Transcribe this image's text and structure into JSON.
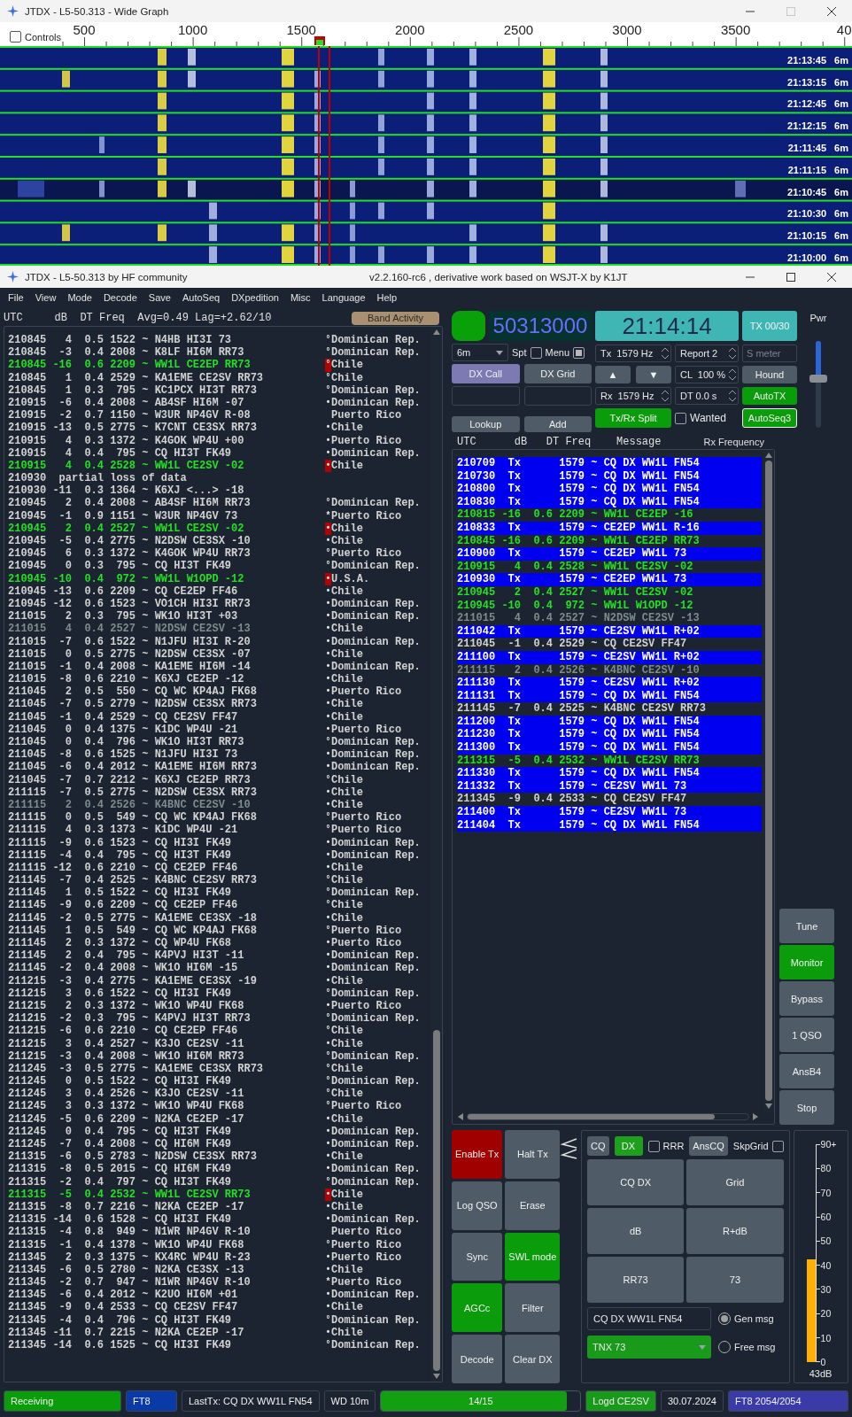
{
  "wide_graph": {
    "title": "JTDX - L5-50.313 - Wide Graph",
    "controls": {
      "label": "Controls",
      "checked": false
    },
    "ticks": [
      "500",
      "1000",
      "1500",
      "2000",
      "2500",
      "3000",
      "3500",
      "40"
    ],
    "rows": [
      {
        "time": "21:13:45",
        "band": "6m"
      },
      {
        "time": "21:13:15",
        "band": "6m"
      },
      {
        "time": "21:12:45",
        "band": "6m"
      },
      {
        "time": "21:12:15",
        "band": "6m"
      },
      {
        "time": "21:11:45",
        "band": "6m"
      },
      {
        "time": "21:11:15",
        "band": "6m"
      },
      {
        "time": "21:10:45",
        "band": "6m"
      },
      {
        "time": "21:10:30",
        "band": "6m"
      },
      {
        "time": "21:10:15",
        "band": "6m"
      },
      {
        "time": "21:10:00",
        "band": "6m"
      }
    ]
  },
  "main_window": {
    "title": "JTDX - L5-50.313  by HF community",
    "version": "v2.2.160-rc6 , derivative work based on WSJT-X by K1JT"
  },
  "menu": [
    "File",
    "View",
    "Mode",
    "Decode",
    "Save",
    "AutoSeq",
    "DXpedition",
    "Misc",
    "Language",
    "Help"
  ],
  "band_activity": {
    "header": "UTC     dB  DT Freq  Avg=0.49 Lag=+2.62/10",
    "button": "Band Activity",
    "rows": [
      {
        "kind": "decode",
        "text": "210845   4  0.5 1522 ~ N4HB HI3I 73",
        "mark": "°",
        "country": "Dominican Rep."
      },
      {
        "kind": "decode",
        "text": "210845  -3  0.4 2008 ~ K8LF HI6M RR73",
        "mark": "°",
        "country": "Dominican Rep."
      },
      {
        "kind": "mine",
        "text": "210845 -16  0.6 2209 ~ WW1L CE2EP RR73",
        "mark": "°",
        "country": "Chile"
      },
      {
        "kind": "decode",
        "text": "210845   1  0.4 2529 ~ KA1EME CE2SV RR73",
        "mark": "°",
        "country": "Chile"
      },
      {
        "kind": "decode",
        "text": "210845   1  0.3  795 ~ KC1PCX HI3T RR73",
        "mark": "°",
        "country": "Dominican Rep."
      },
      {
        "kind": "decode",
        "text": "210915  -6  0.4 2008 ~ AB4SF HI6M -07",
        "mark": "•",
        "country": "Dominican Rep."
      },
      {
        "kind": "decode",
        "text": "210915  -2  0.7 1150 ~ W3UR NP4GV R-08",
        "country": "Puerto Rico"
      },
      {
        "kind": "decode",
        "text": "210915 -13  0.5 2775 ~ K7CNT CE3SX RR73",
        "mark": "•",
        "country": "Chile"
      },
      {
        "kind": "decode",
        "text": "210915   4  0.3 1372 ~ K4GOK WP4U +00",
        "mark": "•",
        "country": "Puerto Rico"
      },
      {
        "kind": "decode",
        "text": "210915   4  0.4  795 ~ CQ HI3T FK49",
        "mark": "•",
        "country": "Dominican Rep."
      },
      {
        "kind": "mine",
        "text": "210915   4  0.4 2528 ~ WW1L CE2SV -02",
        "mark": "•",
        "country": "Chile"
      },
      {
        "kind": "note",
        "text": "210930  partial loss of data"
      },
      {
        "kind": "decode",
        "text": "210930 -11  0.3 1364 ~ K6XJ <...> -18"
      },
      {
        "kind": "decode",
        "text": "210945   2  0.4 2008 ~ AB4SF HI6M RR73",
        "mark": "°",
        "country": "Dominican Rep."
      },
      {
        "kind": "decode",
        "text": "210945  -1  0.9 1151 ~ W3UR NP4GV 73",
        "mark": "*",
        "country": "Puerto Rico"
      },
      {
        "kind": "mine",
        "text": "210945   2  0.4 2527 ~ WW1L CE2SV -02",
        "mark": "•",
        "country": "Chile"
      },
      {
        "kind": "decode",
        "text": "210945  -5  0.4 2775 ~ N2DSW CE3SX -10",
        "mark": "•",
        "country": "Chile"
      },
      {
        "kind": "decode",
        "text": "210945   6  0.3 1372 ~ K4GOK WP4U RR73",
        "mark": "°",
        "country": "Puerto Rico"
      },
      {
        "kind": "decode",
        "text": "210945   0  0.3  795 ~ CQ HI3T FK49",
        "mark": "°",
        "country": "Dominican Rep."
      },
      {
        "kind": "mine",
        "text": "210945 -10  0.4  972 ~ WW1L W1OPD -12",
        "mark": "•",
        "country": "U.S.A."
      },
      {
        "kind": "decode",
        "text": "210945 -13  0.6 2209 ~ CQ CE2EP FF46",
        "mark": "•",
        "country": "Chile"
      },
      {
        "kind": "decode",
        "text": "210945 -12  0.6 1523 ~ VO1CH HI3I RR73",
        "mark": "•",
        "country": "Dominican Rep."
      },
      {
        "kind": "decode",
        "text": "211015   2  0.3  795 ~ WK1O HI3T +03",
        "mark": "•",
        "country": "Dominican Rep."
      },
      {
        "kind": "old",
        "text": "211015   4  0.4 2527 ~ N2DSW CE2SV -13",
        "mark": "•",
        "country": "Chile"
      },
      {
        "kind": "decode",
        "text": "211015  -7  0.6 1522 ~ N1JFU HI3I R-20",
        "mark": "•",
        "country": "Dominican Rep."
      },
      {
        "kind": "decode",
        "text": "211015   0  0.5 2775 ~ N2DSW CE3SX -07",
        "mark": "•",
        "country": "Chile"
      },
      {
        "kind": "decode",
        "text": "211015  -1  0.4 2008 ~ KA1EME HI6M -14",
        "mark": "•",
        "country": "Dominican Rep."
      },
      {
        "kind": "decode",
        "text": "211015  -8  0.6 2210 ~ K6XJ CE2EP -12",
        "mark": "•",
        "country": "Chile"
      },
      {
        "kind": "decode",
        "text": "211045   2  0.5  550 ~ CQ WC KP4AJ FK68",
        "mark": "•",
        "country": "Puerto Rico"
      },
      {
        "kind": "decode",
        "text": "211045  -7  0.5 2779 ~ N2DSW CE3SX RR73",
        "mark": "•",
        "country": "Chile"
      },
      {
        "kind": "decode",
        "text": "211045  -1  0.4 2529 ~ CQ CE2SV FF47",
        "mark": "•",
        "country": "Chile"
      },
      {
        "kind": "decode",
        "text": "211045   0  0.4 1375 ~ K1DC WP4U -21",
        "mark": "•",
        "country": "Puerto Rico"
      },
      {
        "kind": "decode",
        "text": "211045   0  0.4  796 ~ WK1O HI3T RR73",
        "mark": "°",
        "country": "Dominican Rep."
      },
      {
        "kind": "decode",
        "text": "211045  -8  0.6 1525 ~ N1JFU HI3I 73",
        "mark": "•",
        "country": "Dominican Rep."
      },
      {
        "kind": "decode",
        "text": "211045  -6  0.4 2012 ~ KA1EME HI6M RR73",
        "mark": "•",
        "country": "Dominican Rep."
      },
      {
        "kind": "decode",
        "text": "211045  -7  0.7 2212 ~ K6XJ CE2EP RR73",
        "mark": "°",
        "country": "Chile"
      },
      {
        "kind": "decode",
        "text": "211115  -7  0.5 2775 ~ N2DSW CE3SX RR73",
        "mark": "•",
        "country": "Chile"
      },
      {
        "kind": "old",
        "text": "211115   2  0.4 2526 ~ K4BNC CE2SV -10",
        "mark": "•",
        "country": "Chile"
      },
      {
        "kind": "decode",
        "text": "211115   0  0.5  549 ~ CQ WC KP4AJ FK68",
        "mark": "°",
        "country": "Puerto Rico"
      },
      {
        "kind": "decode",
        "text": "211115   4  0.3 1373 ~ K1DC WP4U -21",
        "mark": "°",
        "country": "Puerto Rico"
      },
      {
        "kind": "decode",
        "text": "211115  -9  0.6 1523 ~ CQ HI3I FK49",
        "mark": "•",
        "country": "Dominican Rep."
      },
      {
        "kind": "decode",
        "text": "211115  -4  0.4  795 ~ CQ HI3T FK49",
        "mark": "•",
        "country": "Dominican Rep."
      },
      {
        "kind": "decode",
        "text": "211115 -12  0.6 2210 ~ CQ CE2EP FF46",
        "mark": "•",
        "country": "Chile"
      },
      {
        "kind": "decode",
        "text": "211145  -7  0.4 2525 ~ K4BNC CE2SV RR73",
        "mark": "°",
        "country": "Chile"
      },
      {
        "kind": "decode",
        "text": "211145   1  0.5 1522 ~ CQ HI3I FK49",
        "mark": "°",
        "country": "Dominican Rep."
      },
      {
        "kind": "decode",
        "text": "211145  -9  0.6 2209 ~ CQ CE2EP FF46",
        "mark": "°",
        "country": "Chile"
      },
      {
        "kind": "decode",
        "text": "211145  -2  0.5 2775 ~ KA1EME CE3SX -18",
        "mark": "•",
        "country": "Chile"
      },
      {
        "kind": "decode",
        "text": "211145   1  0.5  549 ~ CQ WC KP4AJ FK68",
        "mark": "°",
        "country": "Puerto Rico"
      },
      {
        "kind": "decode",
        "text": "211145   2  0.3 1372 ~ CQ WP4U FK68",
        "mark": "•",
        "country": "Puerto Rico"
      },
      {
        "kind": "decode",
        "text": "211145   2  0.4  795 ~ K4PVJ HI3T -11",
        "mark": "•",
        "country": "Dominican Rep."
      },
      {
        "kind": "decode",
        "text": "211145  -2  0.4 2008 ~ WK1O HI6M -15",
        "mark": "•",
        "country": "Dominican Rep."
      },
      {
        "kind": "decode",
        "text": "211215  -3  0.4 2775 ~ KA1EME CE3SX -19",
        "mark": "•",
        "country": "Chile"
      },
      {
        "kind": "decode",
        "text": "211215   3  0.6 1522 ~ CQ HI3I FK49",
        "mark": "°",
        "country": "Dominican Rep."
      },
      {
        "kind": "decode",
        "text": "211215   2  0.3 1372 ~ WK1O WP4U FK68",
        "mark": "•",
        "country": "Puerto Rico"
      },
      {
        "kind": "decode",
        "text": "211215  -2  0.3  795 ~ K4PVJ HI3T RR73",
        "mark": "°",
        "country": "Dominican Rep."
      },
      {
        "kind": "decode",
        "text": "211215  -6  0.6 2210 ~ CQ CE2EP FF46",
        "mark": "°",
        "country": "Chile"
      },
      {
        "kind": "decode",
        "text": "211215   3  0.4 2527 ~ K3JO CE2SV -11",
        "mark": "•",
        "country": "Chile"
      },
      {
        "kind": "decode",
        "text": "211215  -3  0.4 2008 ~ WK1O HI6M RR73",
        "mark": "°",
        "country": "Dominican Rep."
      },
      {
        "kind": "decode",
        "text": "211245  -3  0.5 2775 ~ KA1EME CE3SX RR73",
        "mark": "°",
        "country": "Chile"
      },
      {
        "kind": "decode",
        "text": "211245   0  0.5 1522 ~ CQ HI3I FK49",
        "mark": "°",
        "country": "Dominican Rep."
      },
      {
        "kind": "decode",
        "text": "211245   3  0.4 2526 ~ K3JO CE2SV -11",
        "mark": "°",
        "country": "Chile"
      },
      {
        "kind": "decode",
        "text": "211245   3  0.3 1372 ~ WK1O WP4U FK68",
        "mark": "°",
        "country": "Puerto Rico"
      },
      {
        "kind": "decode",
        "text": "211245  -5  0.6 2209 ~ N2KA CE2EP -17",
        "mark": "•",
        "country": "Chile"
      },
      {
        "kind": "decode",
        "text": "211245   0  0.4  795 ~ CQ HI3T FK49",
        "mark": "•",
        "country": "Dominican Rep."
      },
      {
        "kind": "decode",
        "text": "211245  -7  0.4 2008 ~ CQ HI6M FK49",
        "mark": "•",
        "country": "Dominican Rep."
      },
      {
        "kind": "decode",
        "text": "211315  -6  0.5 2783 ~ N2DSW CE3SX RR73",
        "mark": "•",
        "country": "Chile"
      },
      {
        "kind": "decode",
        "text": "211315  -8  0.5 2015 ~ CQ HI6M FK49",
        "mark": "•",
        "country": "Dominican Rep."
      },
      {
        "kind": "decode",
        "text": "211315  -2  0.4  797 ~ CQ HI3T FK49",
        "mark": "°",
        "country": "Dominican Rep."
      },
      {
        "kind": "mine",
        "text": "211315  -5  0.4 2532 ~ WW1L CE2SV RR73",
        "mark": "•",
        "country": "Chile"
      },
      {
        "kind": "decode",
        "text": "211315  -8  0.7 2216 ~ N2KA CE2EP -17",
        "mark": "•",
        "country": "Chile"
      },
      {
        "kind": "decode",
        "text": "211315 -14  0.6 1528 ~ CQ HI3I FK49",
        "mark": "•",
        "country": "Dominican Rep."
      },
      {
        "kind": "decode",
        "text": "211315  -4  0.8  949 ~ N1WR NP4GV R-10",
        "country": "Puerto Rico"
      },
      {
        "kind": "decode",
        "text": "211315  -1  0.4 1378 ~ WK1O WP4U FK68",
        "mark": "°",
        "country": "Puerto Rico"
      },
      {
        "kind": "decode",
        "text": "211345   2  0.3 1375 ~ KX4RC WP4U R-23",
        "mark": "•",
        "country": "Puerto Rico"
      },
      {
        "kind": "decode",
        "text": "211345  -6  0.5 2780 ~ N2KA CE3SX -13",
        "mark": "•",
        "country": "Chile"
      },
      {
        "kind": "decode",
        "text": "211345  -2  0.7  947 ~ N1WR NP4GV R-10",
        "mark": "*",
        "country": "Puerto Rico"
      },
      {
        "kind": "decode",
        "text": "211345  -6  0.4 2012 ~ K2UO HI6M +01",
        "mark": "•",
        "country": "Dominican Rep."
      },
      {
        "kind": "decode",
        "text": "211345  -9  0.4 2533 ~ CQ CE2SV FF47",
        "mark": "•",
        "country": "Chile"
      },
      {
        "kind": "decode",
        "text": "211345  -4  0.4  796 ~ CQ HI3T FK49",
        "mark": "°",
        "country": "Dominican Rep."
      },
      {
        "kind": "decode",
        "text": "211345 -11  0.7 2215 ~ N2KA CE2EP -17",
        "mark": "•",
        "country": "Chile"
      },
      {
        "kind": "decode",
        "text": "211345 -14  0.6 1525 ~ CQ HI3I FK49",
        "mark": "°",
        "country": "Dominican Rep."
      }
    ]
  },
  "controls": {
    "dial": "50313000",
    "clock": "21:14:14",
    "tx_count": "TX 00/30",
    "band": "6m",
    "spt": {
      "label": "Spt",
      "checked": false
    },
    "menu": {
      "label": "Menu",
      "checked": true
    },
    "tx_freq": "Tx  1579 Hz",
    "report": "Report 2",
    "s_meter": {
      "placeholder": "S meter"
    },
    "dx_call": "DX Call",
    "dx_grid": "DX Grid",
    "up": "▲",
    "down": "▼",
    "cl": "CL  100 %",
    "hound": "Hound",
    "rx_freq": "Rx  1579 Hz",
    "dt": "DT 0.0 s",
    "autotx": {
      "label": "AutoTX",
      "on": true
    },
    "split": {
      "label": "Tx/Rx Split",
      "on": true
    },
    "wanted": {
      "label": "Wanted",
      "checked": false
    },
    "autoseq": {
      "label": "AutoSeq3",
      "on": true
    },
    "lookup": "Lookup",
    "add": "Add",
    "pwr": {
      "label": "Pwr",
      "level": 0.57
    }
  },
  "rx_panel": {
    "header": "UTC      dB   DT Freq    Message",
    "rx_header": "Rx Frequency",
    "rows": [
      {
        "kind": "tx",
        "text": "210709  Tx      1579 ~ CQ DX WW1L FN54"
      },
      {
        "kind": "tx",
        "text": "210730  Tx      1579 ~ CQ DX WW1L FN54"
      },
      {
        "kind": "tx",
        "text": "210800  Tx      1579 ~ CQ DX WW1L FN54"
      },
      {
        "kind": "tx",
        "text": "210830  Tx      1579 ~ CQ DX WW1L FN54"
      },
      {
        "kind": "mine",
        "text": "210815 -16  0.6 2209 ~ WW1L CE2EP -16"
      },
      {
        "kind": "tx",
        "text": "210833  Tx      1579 ~ CE2EP WW1L R-16"
      },
      {
        "kind": "mine",
        "text": "210845 -16  0.6 2209 ~ WW1L CE2EP RR73"
      },
      {
        "kind": "tx",
        "text": "210900  Tx      1579 ~ CE2EP WW1L 73"
      },
      {
        "kind": "mine",
        "text": "210915   4  0.4 2528 ~ WW1L CE2SV -02"
      },
      {
        "kind": "tx",
        "text": "210930  Tx      1579 ~ CE2EP WW1L 73"
      },
      {
        "kind": "mine",
        "text": "210945   2  0.4 2527 ~ WW1L CE2SV -02"
      },
      {
        "kind": "mine",
        "text": "210945 -10  0.4  972 ~ WW1L W1OPD -12"
      },
      {
        "kind": "old",
        "text": "211015   4  0.4 2527 ~ N2DSW CE2SV -13"
      },
      {
        "kind": "tx",
        "text": "211042  Tx      1579 ~ CE2SV WW1L R+02"
      },
      {
        "kind": "decode",
        "text": "211045  -1  0.4 2529 ~ CQ CE2SV FF47"
      },
      {
        "kind": "tx",
        "text": "211100  Tx      1579 ~ CE2SV WW1L R+02"
      },
      {
        "kind": "old",
        "text": "211115   2  0.4 2526 ~ K4BNC CE2SV -10"
      },
      {
        "kind": "tx",
        "text": "211130  Tx      1579 ~ CE2SV WW1L R+02"
      },
      {
        "kind": "tx",
        "text": "211131  Tx      1579 ~ CQ DX WW1L FN54"
      },
      {
        "kind": "decode",
        "text": "211145  -7  0.4 2525 ~ K4BNC CE2SV RR73"
      },
      {
        "kind": "tx",
        "text": "211200  Tx      1579 ~ CQ DX WW1L FN54"
      },
      {
        "kind": "tx",
        "text": "211230  Tx      1579 ~ CQ DX WW1L FN54"
      },
      {
        "kind": "tx",
        "text": "211300  Tx      1579 ~ CQ DX WW1L FN54"
      },
      {
        "kind": "mine",
        "text": "211315  -5  0.4 2532 ~ WW1L CE2SV RR73"
      },
      {
        "kind": "tx",
        "text": "211330  Tx      1579 ~ CQ DX WW1L FN54"
      },
      {
        "kind": "tx",
        "text": "211332  Tx      1579 ~ CE2SV WW1L 73"
      },
      {
        "kind": "decode",
        "text": "211345  -9  0.4 2533 ~ CQ CE2SV FF47"
      },
      {
        "kind": "tx",
        "text": "211400  Tx      1579 ~ CE2SV WW1L 73"
      },
      {
        "kind": "tx",
        "text": "211404  Tx      1579 ~ CQ DX WW1L FN54"
      }
    ]
  },
  "side_buttons": [
    {
      "label": "Tune",
      "on": false
    },
    {
      "label": "Monitor",
      "on": true
    },
    {
      "label": "Bypass",
      "on": false
    },
    {
      "label": "1 QSO",
      "on": false
    },
    {
      "label": "AnsB4",
      "on": false
    },
    {
      "label": "Stop",
      "on": false
    }
  ],
  "enable_tx": {
    "label": "Enable Tx",
    "on": true
  },
  "tx_buttons": [
    {
      "label": "Halt Tx",
      "on": false
    },
    {
      "label": "Log QSO",
      "on": false
    },
    {
      "label": "Erase",
      "on": false
    },
    {
      "label": "Sync",
      "on": false
    },
    {
      "label": "SWL mode",
      "on": true
    },
    {
      "label": "AGCc",
      "on": true
    },
    {
      "label": "Filter",
      "on": false
    },
    {
      "label": "Decode",
      "on": false
    },
    {
      "label": "Clear DX",
      "on": false
    }
  ],
  "messages": {
    "cq": {
      "label": "CQ",
      "on": false
    },
    "dx": {
      "label": "DX",
      "on": true
    },
    "rrr": {
      "label": "RRR",
      "checked": false
    },
    "anscq": "AnsCQ",
    "skpgrid": {
      "label": "SkpGrid",
      "checked": false
    },
    "buttons": [
      "CQ DX",
      "Grid",
      "dB",
      "R+dB",
      "RR73",
      "73"
    ],
    "gen_field": "CQ DX WW1L FN54",
    "free_select": "TNX 73",
    "radios": [
      {
        "label": "Gen msg",
        "selected": true
      },
      {
        "label": "Free msg",
        "selected": false
      }
    ]
  },
  "meter": {
    "scale": [
      "90+",
      "80",
      "70",
      "60",
      "50",
      "40",
      "30",
      "20",
      "10",
      "0"
    ],
    "level": 0.47,
    "reading": "43dB"
  },
  "status": {
    "state": "Receiving",
    "mode": "FT8",
    "last_tx": "LastTx: CQ DX WW1L FN54",
    "wd": "WD 10m",
    "progress": {
      "text": "14/15",
      "level": 0.93
    },
    "logged": "Logd CE2SV",
    "date": "30.07.2024",
    "decoder": "FT8  2054/2054"
  }
}
